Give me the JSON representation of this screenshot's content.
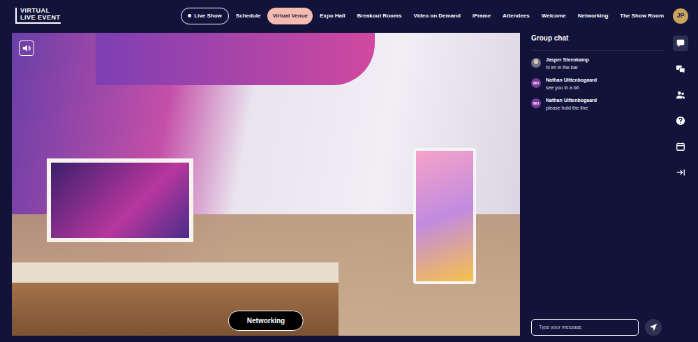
{
  "logo": {
    "line1": "VIRTUAL",
    "line2": "LIVE EVENT"
  },
  "nav": [
    {
      "label": "Live Show",
      "selected": false,
      "kind": "live"
    },
    {
      "label": "Schedule",
      "selected": false,
      "kind": "link"
    },
    {
      "label": "Virtual Venue",
      "selected": true,
      "kind": "link"
    },
    {
      "label": "Expo Hall",
      "selected": false,
      "kind": "link"
    },
    {
      "label": "Breakout Rooms",
      "selected": false,
      "kind": "link"
    },
    {
      "label": "Video on Demand",
      "selected": false,
      "kind": "link"
    },
    {
      "label": "iFrame",
      "selected": false,
      "kind": "link"
    },
    {
      "label": "Attendees",
      "selected": false,
      "kind": "link"
    },
    {
      "label": "Welcome",
      "selected": false,
      "kind": "link"
    },
    {
      "label": "Networking",
      "selected": false,
      "kind": "link"
    },
    {
      "label": "The Show Room",
      "selected": false,
      "kind": "link"
    }
  ],
  "user": {
    "initials": "JP"
  },
  "venue": {
    "button": "Networking"
  },
  "chat": {
    "title": "Group chat",
    "messages": [
      {
        "author": "Jasper Steenkamp",
        "text": "hi im in the bar",
        "kind": "photo"
      },
      {
        "author": "Nathan Uittenbogaard",
        "text": "see you in a bit",
        "kind": "initials",
        "initials": "NU"
      },
      {
        "author": "Nathan Uittenbogaard",
        "text": "please hold the line",
        "kind": "initials",
        "initials": "NU"
      }
    ],
    "placeholder": "Type your message"
  },
  "sidebar": [
    {
      "kind": "chat",
      "selected": true
    },
    {
      "kind": "messages",
      "selected": false
    },
    {
      "kind": "people",
      "selected": false
    },
    {
      "kind": "help",
      "selected": false
    },
    {
      "kind": "calendar",
      "selected": false
    },
    {
      "kind": "collapse",
      "selected": false
    }
  ]
}
